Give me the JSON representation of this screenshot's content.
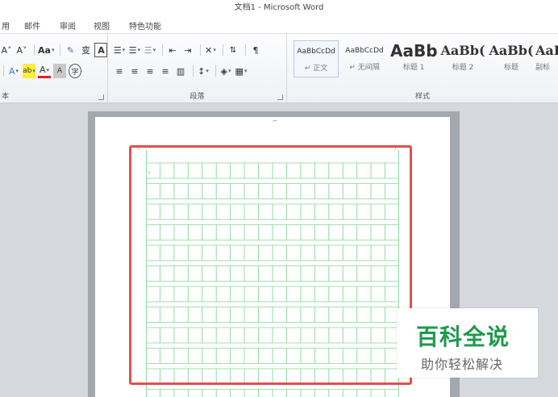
{
  "window": {
    "title": "文档1 - Microsoft Word"
  },
  "menu": {
    "items": [
      "用",
      "邮件",
      "审阅",
      "视图",
      "特色功能"
    ]
  },
  "ribbon": {
    "font_group": {
      "label": "本",
      "row1": [
        "A˄",
        "A˅",
        "Aa",
        "变",
        "A"
      ],
      "row2": [
        "A",
        "ab",
        "A",
        "A",
        "字"
      ]
    },
    "paragraph_group": {
      "label": "段落"
    },
    "styles_group": {
      "label": "样式",
      "tiles": [
        {
          "preview": "AaBbCcDd",
          "name": "↵ 正文"
        },
        {
          "preview": "AaBbCcDd",
          "name": "↵ 无间隔"
        },
        {
          "preview": "AaBb",
          "name": "标题 1"
        },
        {
          "preview": "AaBb(",
          "name": "标题 2"
        },
        {
          "preview": "AaBb(",
          "name": "标题"
        },
        {
          "preview": "AaI",
          "name": "副标"
        }
      ]
    }
  },
  "document": {
    "grid": {
      "columns": 18,
      "rows": 12
    }
  },
  "watermark": {
    "title": "百科全说",
    "subtitle": "助你轻松解决"
  },
  "colors": {
    "highlight": "#e0504f",
    "grid_line": "#8fd89d",
    "watermark_green": "#1d9a4a"
  }
}
